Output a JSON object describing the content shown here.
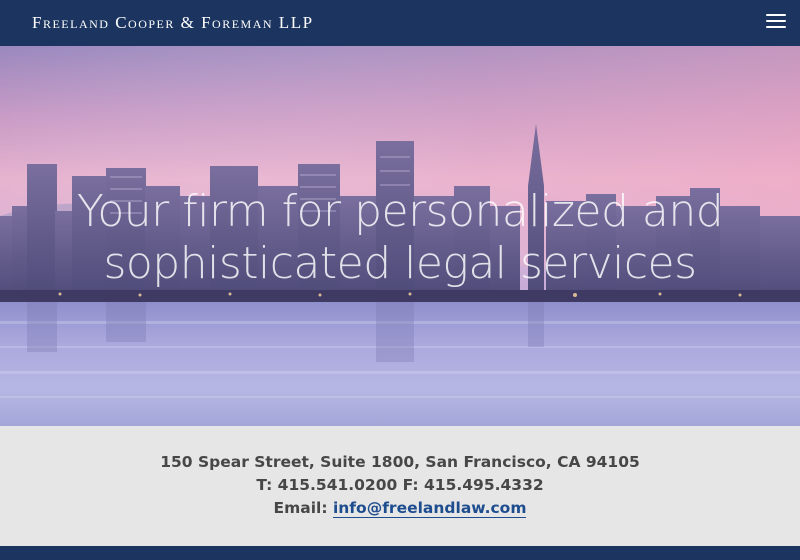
{
  "header": {
    "brand": "Freeland Cooper & Foreman LLP",
    "menu_icon": "hamburger-menu-icon"
  },
  "hero": {
    "image": "san-francisco-skyline-at-dusk",
    "headline_line1": "Your firm for personalized and",
    "headline_line2": "sophisticated legal services"
  },
  "contact": {
    "address": "150 Spear Street, Suite 1800, San Francisco, CA 94105",
    "phone_line": "T: 415.541.0200 F: 415.495.4332",
    "email_label": "Email:",
    "email": "info@freelandlaw.com"
  },
  "colors": {
    "navy": "#1c3560",
    "link": "#1e4d8f",
    "info_bg": "#e6e6e6",
    "text": "#474747"
  }
}
